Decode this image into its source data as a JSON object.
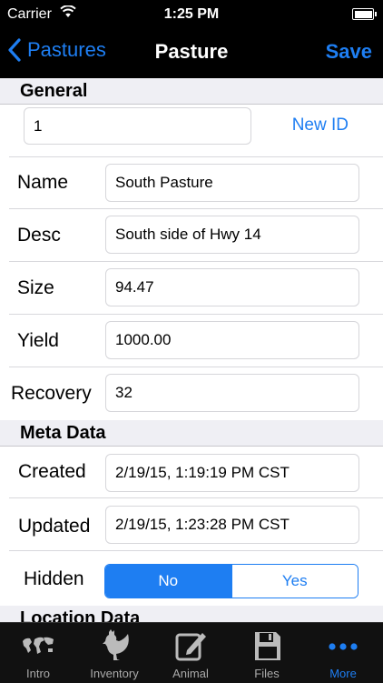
{
  "status": {
    "carrier": "Carrier",
    "time": "1:25 PM"
  },
  "nav": {
    "back_label": "Pastures",
    "title": "Pasture",
    "save_label": "Save"
  },
  "sections": {
    "general": "General",
    "meta": "Meta Data",
    "location": "Location Data"
  },
  "general": {
    "id_value": "1",
    "new_id_label": "New ID",
    "name_label": "Name",
    "name_value": "South Pasture",
    "desc_label": "Desc",
    "desc_value": "South side of Hwy 14",
    "size_label": "Size",
    "size_value": "94.47",
    "yield_label": "Yield",
    "yield_value": "1000.00",
    "recovery_label": "Recovery",
    "recovery_value": "32"
  },
  "meta": {
    "created_label": "Created",
    "created_value": "2/19/15, 1:19:19 PM CST",
    "updated_label": "Updated",
    "updated_value": "2/19/15, 1:23:28 PM CST",
    "hidden_label": "Hidden",
    "hidden_no": "No",
    "hidden_yes": "Yes",
    "hidden_selected": "No"
  },
  "tabs": [
    {
      "label": "Intro",
      "icon": "world-map-icon"
    },
    {
      "label": "Inventory",
      "icon": "rooster-icon"
    },
    {
      "label": "Animal",
      "icon": "edit-icon"
    },
    {
      "label": "Files",
      "icon": "floppy-disk-icon"
    },
    {
      "label": "More",
      "icon": "more-dots-icon"
    }
  ],
  "colors": {
    "accent": "#1e7ef2",
    "bar_background": "#000000",
    "section_background": "#efeff4"
  }
}
